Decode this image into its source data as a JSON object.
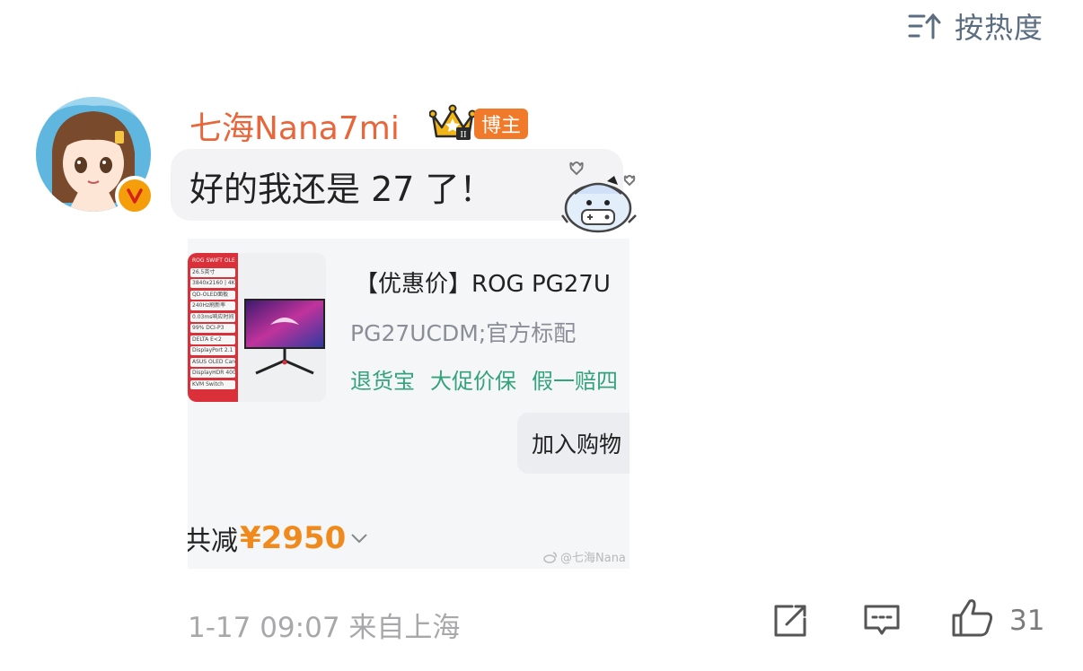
{
  "sort": {
    "label": "按热度",
    "icon": "sort-icon"
  },
  "comment": {
    "username": "七海Nana7mi",
    "badge_label": "博主",
    "crown_level": "II",
    "text": "好的我还是 27 了！",
    "timestamp": "1-17 09:07 来自上海",
    "like_count": "31"
  },
  "product_card": {
    "spec_header": "ROG SWIFT OLED PG27UCDM",
    "specs": [
      "26.5英寸",
      "3840x2160 | 4K分辨率",
      "QD-OLED面板",
      "240Hz刷新率",
      "0.03ms响应时间",
      "99% DCI-P3",
      "DELTA E<2",
      "DisplayPort 2.1 DSC",
      "ASUS OLED Care",
      "DisplayHDR 400",
      "KVM Switch"
    ],
    "title": "【优惠价】ROG PG27U",
    "sku": "PG27UCDM;官方标配",
    "tags": [
      "退货宝",
      "大促价保",
      "假一赔四"
    ],
    "cart_label": "加入购物",
    "discount_prefix": "共减",
    "discount_amount": "¥2950",
    "watermark": "@七海Nana"
  },
  "colors": {
    "username": "#e8663a",
    "badge": "#f07a2a",
    "tags": "#34a27a",
    "discount": "#f08a1c",
    "sort_text": "#5b6d80"
  }
}
